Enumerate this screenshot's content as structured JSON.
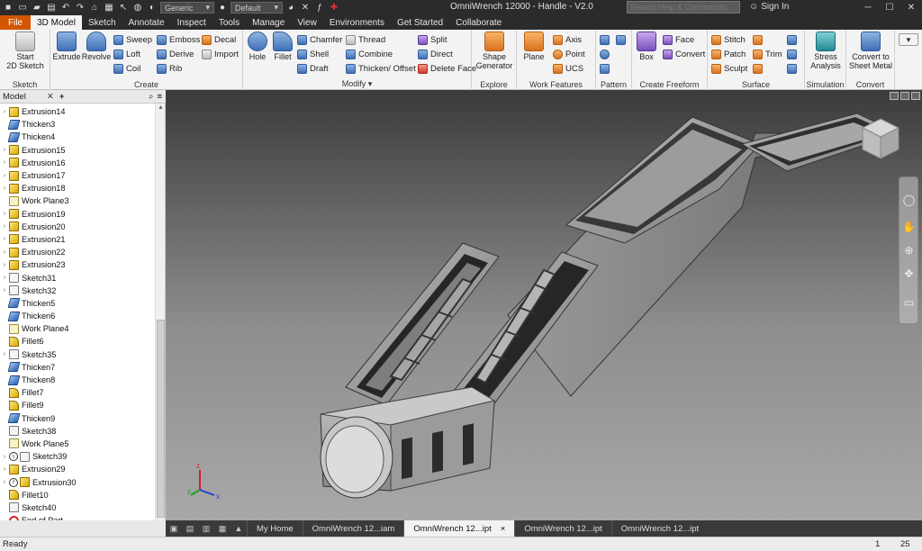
{
  "window": {
    "title": "OmniWrench 12000 - Handle - V2.0",
    "search_placeholder": "Search Help & Commands...",
    "signin": "Sign In",
    "material_combo": "Generic",
    "appearance_combo": "Default"
  },
  "tabs": [
    {
      "label": "File",
      "kind": "file"
    },
    {
      "label": "3D Model",
      "kind": "active"
    },
    {
      "label": "Sketch"
    },
    {
      "label": "Annotate"
    },
    {
      "label": "Inspect"
    },
    {
      "label": "Tools"
    },
    {
      "label": "Manage"
    },
    {
      "label": "View"
    },
    {
      "label": "Environments"
    },
    {
      "label": "Get Started"
    },
    {
      "label": "Collaborate"
    }
  ],
  "ribbon": {
    "sketch": {
      "title": "Sketch",
      "start": "Start\n2D Sketch"
    },
    "create": {
      "title": "Create",
      "extrude": "Extrude",
      "revolve": "Revolve",
      "sweep": "Sweep",
      "loft": "Loft",
      "coil": "Coil",
      "emboss": "Emboss",
      "derive": "Derive",
      "rib": "Rib",
      "decal": "Decal",
      "import": "Import"
    },
    "modify": {
      "title": "Modify",
      "hole": "Hole",
      "fillet": "Fillet",
      "chamfer": "Chamfer",
      "shell": "Shell",
      "draft": "Draft",
      "thread": "Thread",
      "combine": "Combine",
      "thicken": "Thicken/ Offset",
      "split": "Split",
      "direct": "Direct",
      "delete_face": "Delete Face"
    },
    "explore": {
      "title": "Explore",
      "shape_gen": "Shape\nGenerator"
    },
    "work": {
      "title": "Work Features",
      "plane": "Plane",
      "axis": "Axis",
      "point": "Point",
      "ucs": "UCS"
    },
    "pattern": {
      "title": "Pattern"
    },
    "freeform": {
      "title": "Create Freeform",
      "box": "Box",
      "face": "Face",
      "convert": "Convert"
    },
    "surface": {
      "title": "Surface",
      "stitch": "Stitch",
      "patch": "Patch",
      "sculpt": "Sculpt",
      "trim": "Trim"
    },
    "simulation": {
      "title": "Simulation",
      "stress": "Stress\nAnalysis"
    },
    "convert": {
      "title": "Convert",
      "sheet_metal": "Convert to\nSheet Metal"
    }
  },
  "browser": {
    "tab": "Model",
    "nodes": [
      {
        "label": "Extrusion14",
        "type": "extr",
        "exp": true
      },
      {
        "label": "Thicken3",
        "type": "thick"
      },
      {
        "label": "Thicken4",
        "type": "thick"
      },
      {
        "label": "Extrusion15",
        "type": "extr",
        "exp": true
      },
      {
        "label": "Extrusion16",
        "type": "extr",
        "exp": true
      },
      {
        "label": "Extrusion17",
        "type": "extr",
        "exp": true
      },
      {
        "label": "Extrusion18",
        "type": "extr",
        "exp": true
      },
      {
        "label": "Work Plane3",
        "type": "plane"
      },
      {
        "label": "Extrusion19",
        "type": "extr",
        "exp": true
      },
      {
        "label": "Extrusion20",
        "type": "extr",
        "exp": true
      },
      {
        "label": "Extrusion21",
        "type": "extr",
        "exp": true
      },
      {
        "label": "Extrusion22",
        "type": "extr",
        "exp": true
      },
      {
        "label": "Extrusion23",
        "type": "extr",
        "exp": true
      },
      {
        "label": "Sketch31",
        "type": "sketch",
        "exp": true
      },
      {
        "label": "Sketch32",
        "type": "sketch",
        "exp": true
      },
      {
        "label": "Thicken5",
        "type": "thick"
      },
      {
        "label": "Thicken6",
        "type": "thick"
      },
      {
        "label": "Work Plane4",
        "type": "plane"
      },
      {
        "label": "Fillet6",
        "type": "fillet"
      },
      {
        "label": "Sketch35",
        "type": "sketch",
        "exp": true
      },
      {
        "label": "Thicken7",
        "type": "thick"
      },
      {
        "label": "Thicken8",
        "type": "thick"
      },
      {
        "label": "Fillet7",
        "type": "fillet"
      },
      {
        "label": "Fillet9",
        "type": "fillet"
      },
      {
        "label": "Thicken9",
        "type": "thick"
      },
      {
        "label": "Sketch38",
        "type": "sketch"
      },
      {
        "label": "Work Plane5",
        "type": "plane"
      },
      {
        "label": "Sketch39",
        "type": "sketch",
        "exp": true,
        "warn": true
      },
      {
        "label": "Extrusion29",
        "type": "extr",
        "exp": true
      },
      {
        "label": "Extrusion30",
        "type": "extr",
        "exp": true,
        "warn": true
      },
      {
        "label": "Fillet10",
        "type": "fillet"
      },
      {
        "label": "Sketch40",
        "type": "sketch"
      },
      {
        "label": "End of Part",
        "type": "end"
      }
    ]
  },
  "doc_tabs": [
    {
      "label": "My Home"
    },
    {
      "label": "OmniWrench 12...iam"
    },
    {
      "label": "OmniWrench 12...ipt",
      "active": true,
      "close": "×"
    },
    {
      "label": "OmniWrench 12...ipt"
    },
    {
      "label": "OmniWrench 12...ipt"
    }
  ],
  "status": {
    "text": "Ready",
    "count1": "1",
    "count2": "25"
  },
  "viewport": {
    "triad": {
      "x": "x",
      "y": "y",
      "z": "z"
    }
  },
  "colors": {
    "file_tab": "#d45500",
    "viewport_top": "#3b3b3b",
    "viewport_bottom": "#a8a8a8"
  }
}
